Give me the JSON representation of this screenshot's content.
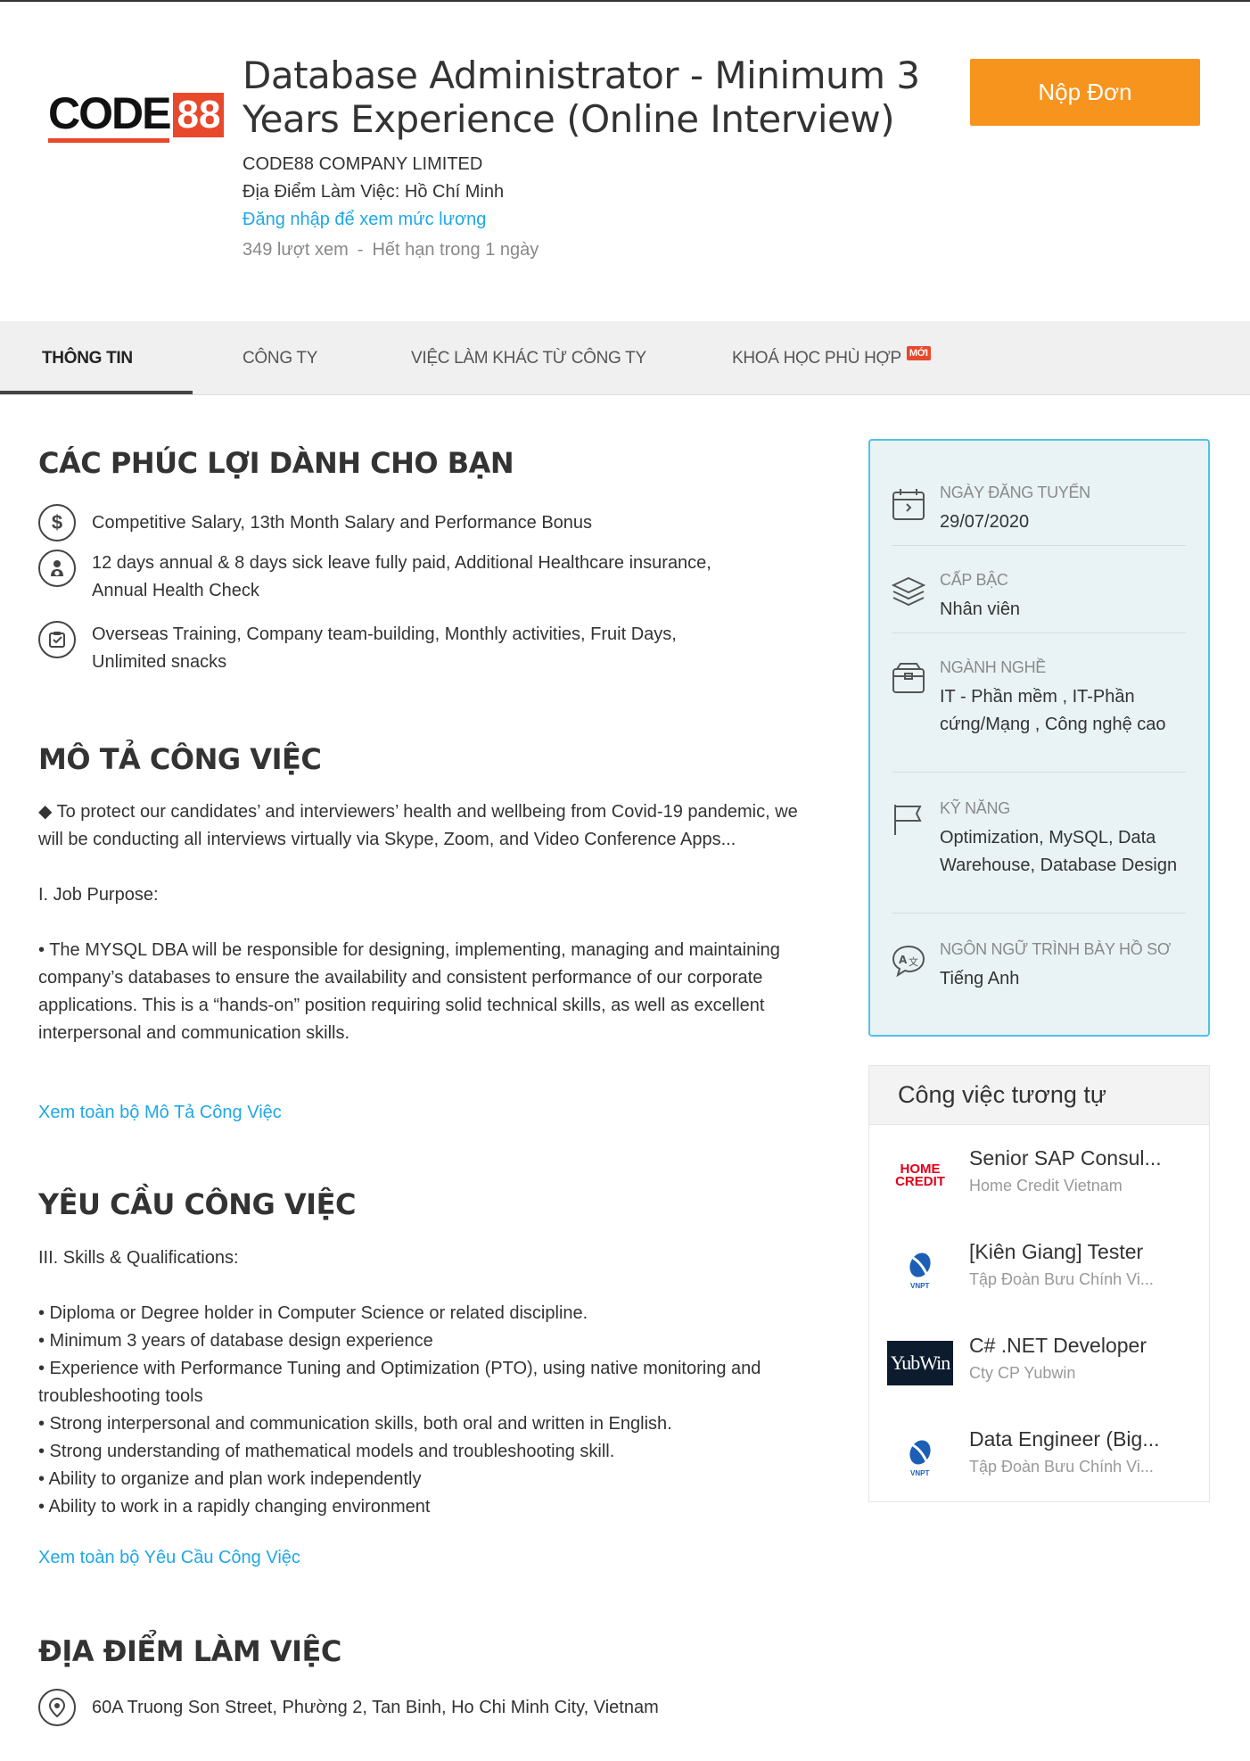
{
  "header": {
    "logo_text": "CODE",
    "logo_number": "88",
    "title": "Database Administrator - Minimum 3 Years Experience (Online Interview)",
    "company": "CODE88 COMPANY LIMITED",
    "location": "Địa Điểm Làm Việc: Hồ Chí Minh",
    "salary_link": "Đăng nhập để xem mức lương",
    "views": "349 lượt xem",
    "separator": "-",
    "expires": "Hết hạn trong 1 ngày",
    "apply_label": "Nộp Đơn"
  },
  "tabs": [
    {
      "label": "THÔNG TIN",
      "active": true
    },
    {
      "label": "CÔNG TY"
    },
    {
      "label": "VIỆC LÀM KHÁC TỪ CÔNG TY"
    },
    {
      "label": "KHOÁ HỌC PHÙ HỢP",
      "badge": "MỚI"
    }
  ],
  "benefits": {
    "heading": "CÁC PHÚC LỢI DÀNH CHO BẠN",
    "items": [
      {
        "icon": "dollar-icon",
        "text": "Competitive Salary, 13th Month Salary and Performance Bonus"
      },
      {
        "icon": "health-icon",
        "text": "12 days annual & 8 days sick leave fully paid, Additional Healthcare insurance, Annual Health Check"
      },
      {
        "icon": "checklist-icon",
        "text": "Overseas Training, Company team-building, Monthly activities, Fruit Days, Unlimited snacks"
      }
    ]
  },
  "description": {
    "heading": "MÔ TẢ CÔNG VIỆC",
    "text": "◆ To protect our candidates’ and interviewers’ health and wellbeing from Covid-19 pandemic, we will be conducting all interviews virtually via Skype, Zoom, and Video Conference Apps...\n\nI. Job Purpose:\n\n• The MYSQL DBA will be responsible for designing, implementing, managing and maintaining company’s databases to ensure the availability and consistent performance of our corporate applications. This is a “hands-on” position requiring solid technical skills, as well as excellent interpersonal and communication skills.",
    "more_link": "Xem toàn bộ Mô Tả Công Việc"
  },
  "requirements": {
    "heading": "YÊU CẦU CÔNG VIỆC",
    "text": "III. Skills & Qualifications:\n\n• Diploma or Degree holder in Computer Science or related discipline.\n• Minimum 3 years of database design experience\n• Experience with Performance Tuning and Optimization (PTO), using native monitoring and troubleshooting tools\n• Strong interpersonal and communication skills, both oral and written in English.\n• Strong understanding of mathematical models and troubleshooting skill.\n• Ability to organize and plan work independently\n• Ability to work in a rapidly changing environment",
    "more_link": "Xem toàn bộ Yêu Cầu Công Việc"
  },
  "location_section": {
    "heading": "ĐỊA ĐIỂM LÀM VIỆC",
    "address": "60A Truong Son Street, Phường 2, Tan Binh, Ho Chi Minh City, Vietnam"
  },
  "info_card": {
    "accent": "#54c0e8",
    "rows": [
      {
        "icon": "calendar-icon",
        "label": "NGÀY ĐĂNG TUYỂN",
        "value": "29/07/2020"
      },
      {
        "icon": "layers-icon",
        "label": "CẤP BẬC",
        "value": "Nhân viên"
      },
      {
        "icon": "briefcase-icon",
        "label": "NGÀNH NGHỀ",
        "value": "IT - Phần mềm , IT-Phần cứng/Mạng , Công nghệ cao"
      },
      {
        "icon": "flag-icon",
        "label": "KỸ NĂNG",
        "value": "Optimization, MySQL, Data Warehouse, Database Design"
      },
      {
        "icon": "language-icon",
        "label": "NGÔN NGỮ TRÌNH BÀY HỒ SƠ",
        "value": "Tiếng Anh"
      }
    ]
  },
  "similar_jobs": {
    "heading": "Công việc tương tự",
    "items": [
      {
        "logo": "HOME CREDIT",
        "logo_line1": "HOME",
        "logo_line2": "CREDIT",
        "title": "Senior SAP Consul...",
        "company": "Home Credit Vietnam"
      },
      {
        "logo": "VNPT",
        "title": "[Kiên Giang] Tester",
        "company": "Tập Đoàn Bưu Chính Vi..."
      },
      {
        "logo": "YUBWIN",
        "logo_text": "YubWin",
        "title": "C# .NET Developer",
        "company": "Cty CP Yubwin"
      },
      {
        "logo": "VNPT",
        "title": "Data Engineer (Big...",
        "company": "Tập Đoàn Bưu Chính Vi..."
      }
    ]
  },
  "colors": {
    "brand_orange": "#f7941d",
    "link_blue": "#1fa7e6",
    "code88_red": "#e8482c"
  }
}
